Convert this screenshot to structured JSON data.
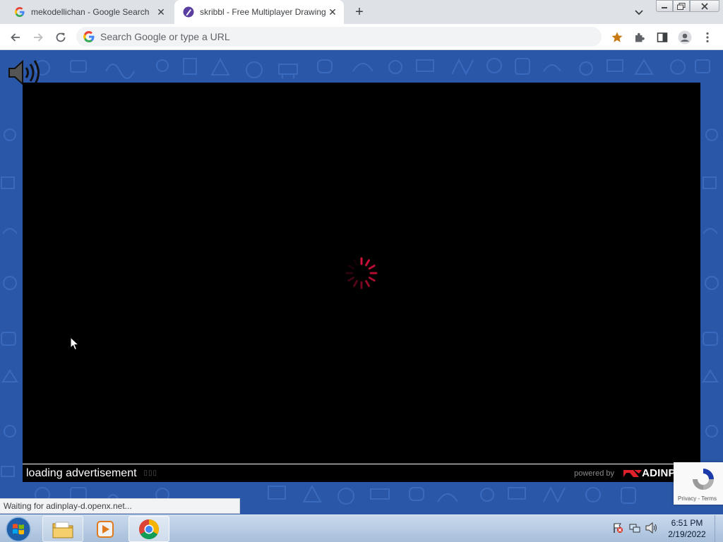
{
  "browser": {
    "tabs": [
      {
        "title": "mekodellichan - Google Search",
        "favicon": "google-g-icon",
        "active": false
      },
      {
        "title": "skribbl - Free Multiplayer Drawing",
        "favicon": "skribbl-pen-icon",
        "active": true
      }
    ],
    "new_tab_symbol": "+",
    "tab_close_symbol": "✕",
    "omnibox": {
      "placeholder": "Search Google or type a URL",
      "value": ""
    },
    "status": "Waiting for adinplay-d.openx.net..."
  },
  "page": {
    "background_color": "#2b57a8",
    "ad": {
      "loading_text": "loading advertisement",
      "powered_by": "powered by",
      "brand": "ADINPLAY"
    },
    "recaptcha": {
      "terms": "Privacy - Terms"
    }
  },
  "taskbar": {
    "time": "6:51 PM",
    "date": "2/19/2022"
  },
  "colors": {
    "spinner": "#d0103a",
    "brand_red": "#e0202a",
    "ad_background": "#000000"
  }
}
